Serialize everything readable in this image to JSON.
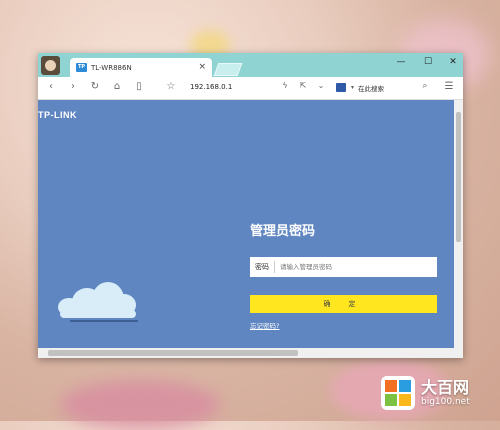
{
  "browser": {
    "tab_title": "TL-WR886N",
    "tab_favicon": "TP",
    "address": "192.168.0.1",
    "search_placeholder": "在此搜索"
  },
  "router": {
    "brand": "TP-LINK",
    "login_title": "管理员密码",
    "password_label": "密码",
    "password_placeholder": "请输入管理员密码",
    "confirm_label": "确 定",
    "forgot_link": "忘记密码?"
  },
  "colors": {
    "page_bg": "#5f86c1",
    "titlebar": "#8fd3d3",
    "confirm_button": "#ffe61f"
  },
  "watermark": {
    "title": "大百网",
    "url": "big100.net"
  }
}
